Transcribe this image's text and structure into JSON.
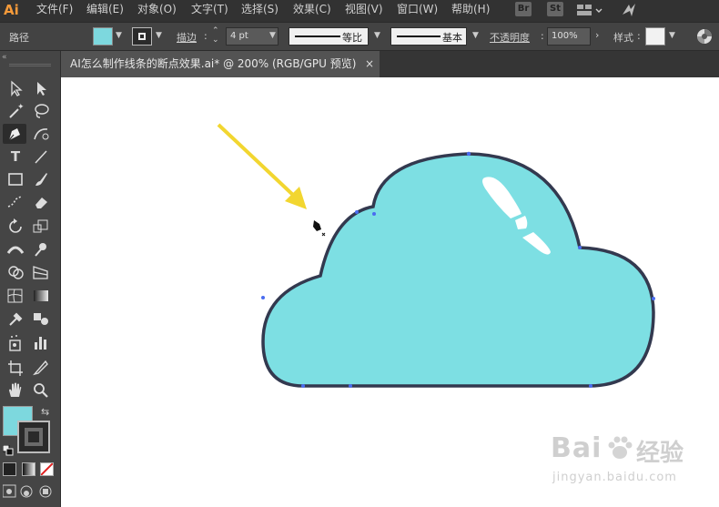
{
  "app": {
    "logo": "Ai"
  },
  "menu": [
    "文件(F)",
    "编辑(E)",
    "对象(O)",
    "文字(T)",
    "选择(S)",
    "效果(C)",
    "视图(V)",
    "窗口(W)",
    "帮助(H)"
  ],
  "menu_icons": [
    "Br",
    "St"
  ],
  "control": {
    "object_type": "路径",
    "fill_color": "#7dd8de",
    "stroke_label": "描边",
    "stroke_weight": "4 pt",
    "profile_label": "等比",
    "brush_label": "基本",
    "opacity_label": "不透明度",
    "opacity_value": "100%",
    "style_label": "样式"
  },
  "tab": {
    "title": "AI怎么制作线条的断点效果.ai* @ 200% (RGB/GPU 预览)",
    "close": "×"
  },
  "colors": {
    "cloud_fill": "#7ddfe3",
    "cloud_stroke": "#33394f",
    "arrow": "#f2d630",
    "fill_swatch": "#7dd8de"
  },
  "watermark": {
    "brand": "Bai",
    "brand_cn": "经验",
    "url": "jingyan.baidu.com"
  }
}
